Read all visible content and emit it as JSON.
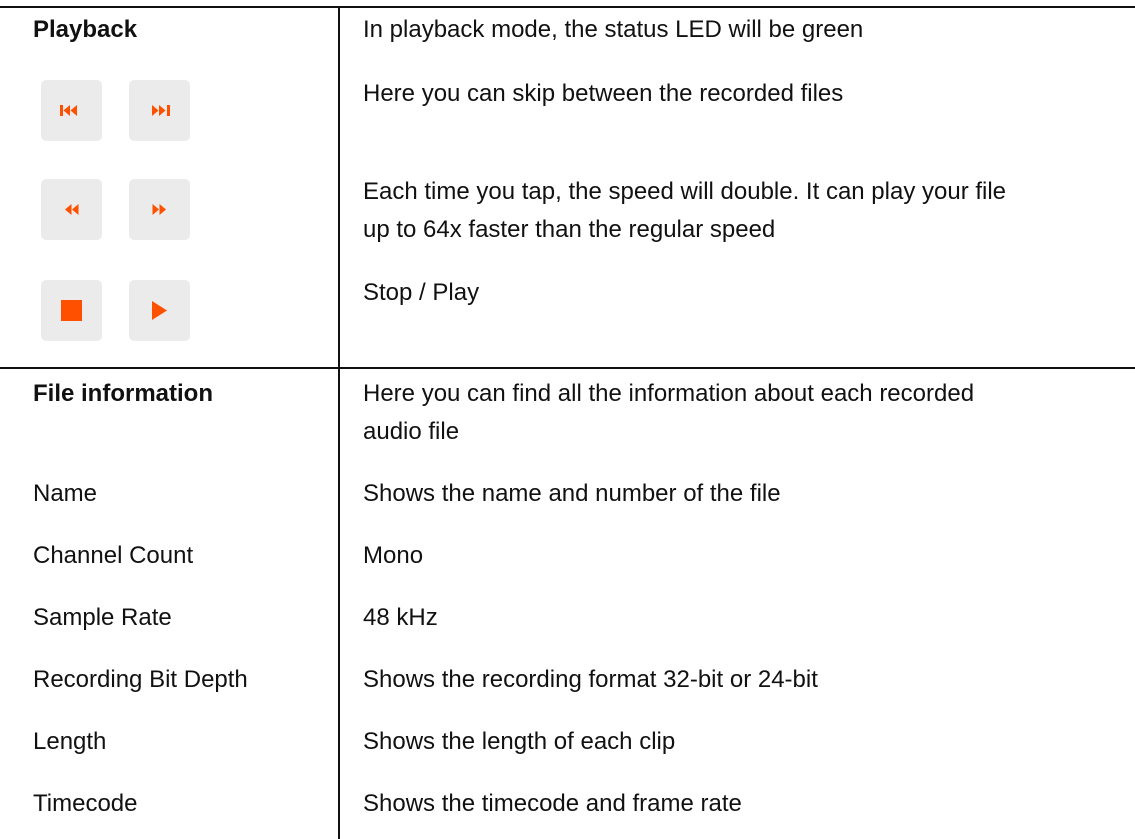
{
  "playback": {
    "heading": "Playback",
    "status_desc": "In playback mode, the status LED will be green",
    "skip_desc": "Here you can skip between the recorded files",
    "speed_desc_line1": "Each time you tap, the speed will double. It can play your file",
    "speed_desc_line2": "up to 64x faster than the regular speed",
    "stop_play_desc": "Stop / Play",
    "buttons": [
      {
        "icon": "skip-back-icon"
      },
      {
        "icon": "skip-forward-icon"
      },
      {
        "icon": "rewind-icon"
      },
      {
        "icon": "fast-forward-icon"
      },
      {
        "icon": "stop-icon"
      },
      {
        "icon": "play-icon"
      }
    ],
    "accent_color": "#ff5000"
  },
  "file_info": {
    "heading": "File information",
    "desc_line1": "Here you can find all the information about each recorded",
    "desc_line2": "audio file",
    "rows": [
      {
        "label": "Name",
        "value": "Shows the name and number of the file"
      },
      {
        "label": "Channel Count",
        "value": "Mono"
      },
      {
        "label": "Sample Rate",
        "value": "48 kHz"
      },
      {
        "label": "Recording Bit Depth",
        "value": "Shows the recording format 32-bit or 24-bit"
      },
      {
        "label": "Length",
        "value": "Shows the length of each clip"
      },
      {
        "label": "Timecode",
        "value": "Shows the timecode and frame rate"
      }
    ]
  }
}
